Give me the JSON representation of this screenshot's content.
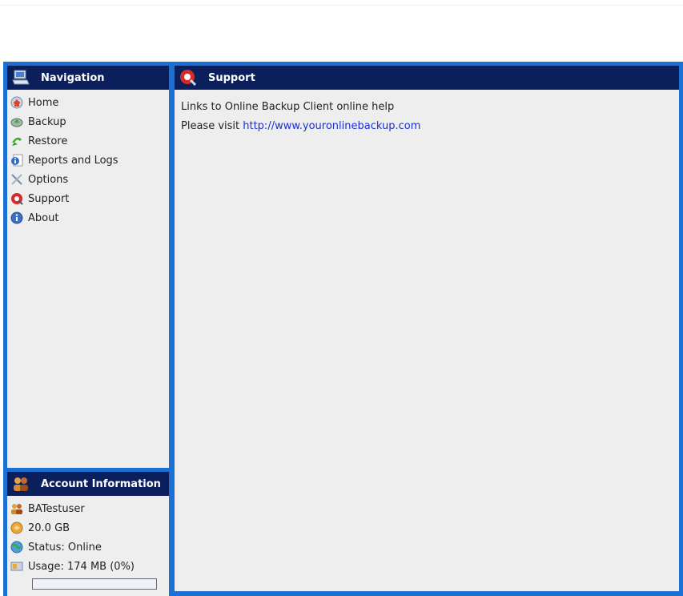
{
  "navigation": {
    "title": "Navigation",
    "icon": "computer-icon",
    "items": [
      {
        "label": "Home",
        "icon": "home-icon"
      },
      {
        "label": "Backup",
        "icon": "backup-icon"
      },
      {
        "label": "Restore",
        "icon": "restore-icon"
      },
      {
        "label": "Reports and Logs",
        "icon": "reports-icon"
      },
      {
        "label": "Options",
        "icon": "options-icon"
      },
      {
        "label": "Support",
        "icon": "support-icon"
      },
      {
        "label": "About",
        "icon": "about-icon"
      }
    ]
  },
  "account": {
    "title": "Account Information",
    "icon": "users-icon",
    "username": "BATestuser",
    "quota": "20.0 GB",
    "status": "Status: Online",
    "usage": "Usage: 174 MB (0%)",
    "usage_fraction": 0.0
  },
  "support": {
    "title": "Support",
    "line1": "Links to Online Backup Client online help",
    "line2_prefix": "Please visit ",
    "link": "http://www.youronlinebackup.com"
  },
  "colors": {
    "frame": "#1c6fd3",
    "header": "#0a1f5c",
    "panel": "#eeeeee",
    "link": "#1a2fd6"
  }
}
